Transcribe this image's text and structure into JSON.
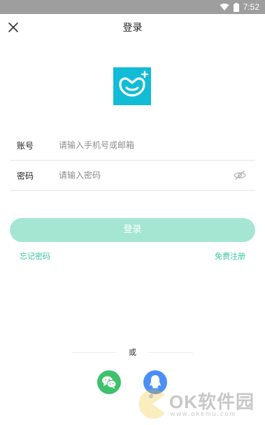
{
  "status_bar": {
    "time": "7:52",
    "icons": [
      "wifi-icon",
      "battery-icon"
    ]
  },
  "header": {
    "title": "登录",
    "close_icon": "close-icon"
  },
  "logo": {
    "icon": "app-logo-icon",
    "color": "#12bcd6"
  },
  "form": {
    "account": {
      "label": "账号",
      "placeholder": "请输入手机号或邮箱",
      "value": ""
    },
    "password": {
      "label": "密码",
      "placeholder": "请输入密码",
      "value": "",
      "toggle_icon": "eye-hidden-icon"
    }
  },
  "actions": {
    "login_label": "登录",
    "forgot_password": "忘记密码",
    "register": "免费注册"
  },
  "social": {
    "divider_text": "或",
    "providers": [
      "wechat-icon",
      "qq-icon"
    ]
  },
  "watermark": {
    "brand": "OK软件园",
    "url": "www.okemu.com"
  },
  "colors": {
    "accent": "#3cc3a0",
    "login_button": "#a5e6d3",
    "status_bar": "#9e9e9e",
    "wechat": "#3fc16c",
    "qq": "#4d8ef5"
  }
}
